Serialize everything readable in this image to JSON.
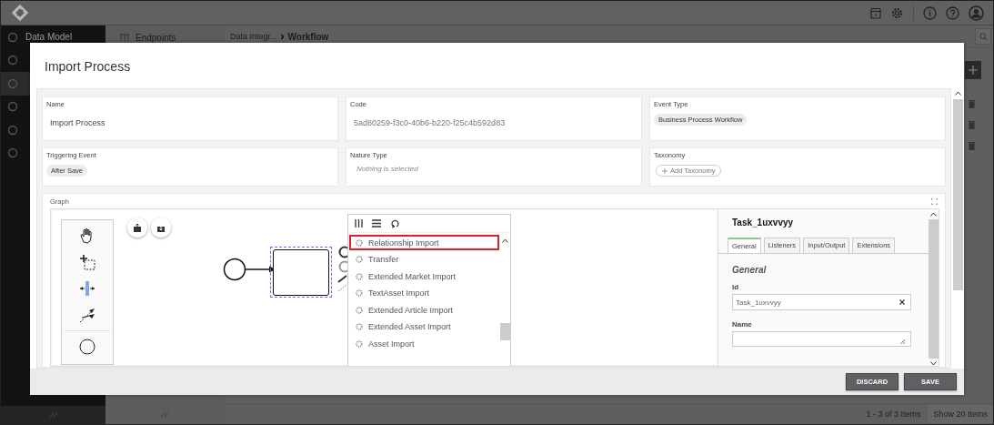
{
  "app": {
    "sidebar_items": [
      {
        "label": "Data Model",
        "selected": false
      },
      {
        "selected": false
      },
      {
        "selected": true
      },
      {
        "selected": false
      },
      {
        "selected": false
      },
      {
        "selected": false
      }
    ],
    "panel_title": "Endpoints",
    "breadcrumb": {
      "parent": "Data Integr...",
      "separator": "›",
      "current": "Workflow"
    },
    "pager": {
      "range": "1 - 3 of 3 Items",
      "page_size": "Show 20 Items"
    }
  },
  "modal": {
    "title": "Import Process",
    "fields": [
      {
        "label": "Name",
        "kind": "text",
        "value": "Import Process"
      },
      {
        "label": "Code",
        "kind": "readonly",
        "value": "5ad80259-f3c0-40b6-b220-f25c4b592d83"
      },
      {
        "label": "Event Type",
        "kind": "chip",
        "value": "Business Process Workflow"
      },
      {
        "label": "Triggering Event",
        "kind": "chip",
        "value": "After Save"
      },
      {
        "label": "Nature Type",
        "kind": "placeholder",
        "placeholder": "Nothing is selected"
      },
      {
        "label": "Taxonomy",
        "kind": "add",
        "value": "Add Taxonomy"
      }
    ],
    "graph": {
      "label": "Graph",
      "menu": {
        "items": [
          {
            "label": "Relationship Import",
            "selected": true
          },
          {
            "label": "Transfer",
            "selected": false
          },
          {
            "label": "Extended Market Import",
            "selected": false
          },
          {
            "label": "TextAsset Import",
            "selected": false
          },
          {
            "label": "Extended Article Import",
            "selected": false
          },
          {
            "label": "Extended Asset Import",
            "selected": false
          },
          {
            "label": "Asset Import",
            "selected": false
          }
        ]
      },
      "properties": {
        "title": "Task_1uxvvyy",
        "tabs": [
          {
            "label": "General",
            "selected": true
          },
          {
            "label": "Listeners",
            "selected": false
          },
          {
            "label": "Input/Output",
            "selected": false
          },
          {
            "label": "Extensions",
            "selected": false
          }
        ],
        "section": "General",
        "fields": [
          {
            "label": "Id",
            "kind": "input",
            "value": "Task_1uxvvyy"
          },
          {
            "label": "Name",
            "kind": "textarea"
          }
        ]
      }
    },
    "buttons": [
      {
        "label": "DISCARD"
      },
      {
        "label": "SAVE"
      }
    ]
  }
}
